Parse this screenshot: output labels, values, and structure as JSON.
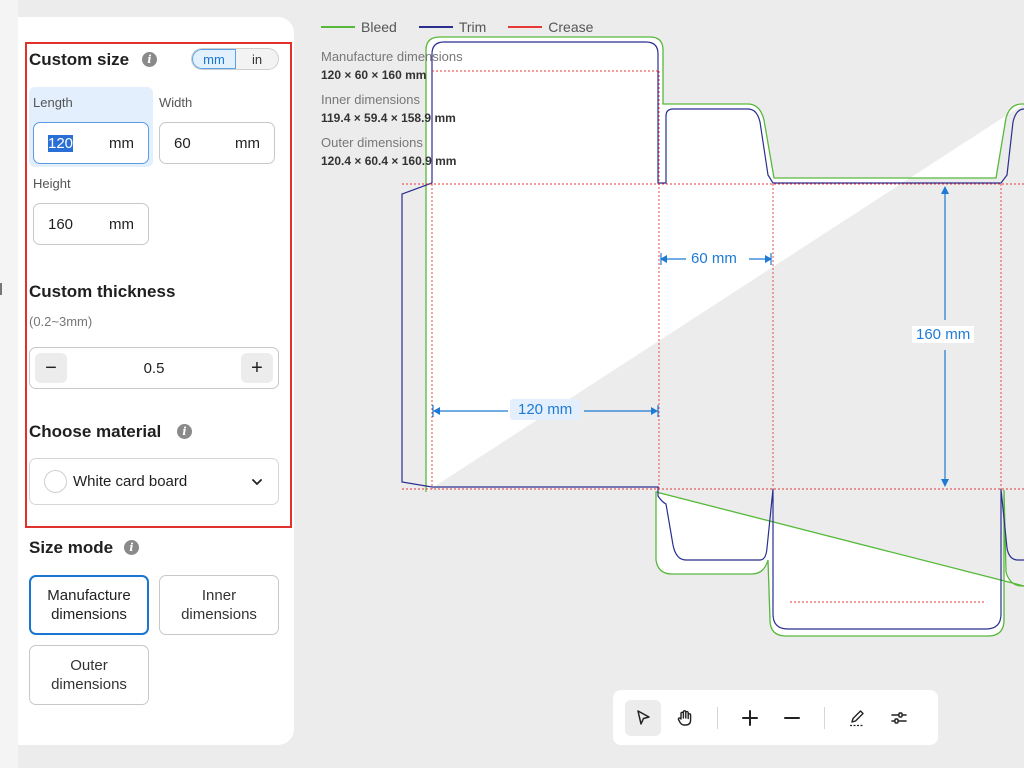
{
  "panel": {
    "custom_size": {
      "title": "Custom size",
      "info_icon": "info-icon",
      "unit_options": [
        "mm",
        "in"
      ],
      "selected_unit": "mm",
      "length": {
        "label": "Length",
        "value": "120",
        "unit": "mm"
      },
      "width": {
        "label": "Width",
        "value": "60",
        "unit": "mm"
      },
      "height": {
        "label": "Height",
        "value": "160",
        "unit": "mm"
      }
    },
    "thickness": {
      "title": "Custom thickness",
      "range": "(0.2~3mm)",
      "value": "0.5",
      "minus": "−",
      "plus": "+"
    },
    "material": {
      "title": "Choose material",
      "selected": "White card board"
    },
    "size_mode": {
      "title": "Size mode",
      "options": [
        "Manufacture dimensions",
        "Inner dimensions",
        "Outer dimensions"
      ],
      "selected": "Manufacture dimensions"
    }
  },
  "legend": [
    {
      "label": "Bleed",
      "color": "#57b93a"
    },
    {
      "label": "Trim",
      "color": "#2a2f8f"
    },
    {
      "label": "Crease",
      "color": "#e53935"
    }
  ],
  "dimensions_info": {
    "manufacture_label": "Manufacture dimensions",
    "manufacture_value": "120 × 60 × 160 mm",
    "inner_label": "Inner dimensions",
    "inner_value": "119.4 × 59.4 × 158.9 mm",
    "outer_label": "Outer dimensions",
    "outer_value": "120.4 × 60.4 × 160.9 mm"
  },
  "canvas_dims": {
    "width": "60 mm",
    "height": "160 mm",
    "length": "120 mm"
  },
  "toolbar": {
    "tools": [
      "select-tool",
      "pan-tool",
      "zoom-in",
      "zoom-out",
      "edit-tool",
      "settings-tool"
    ]
  }
}
